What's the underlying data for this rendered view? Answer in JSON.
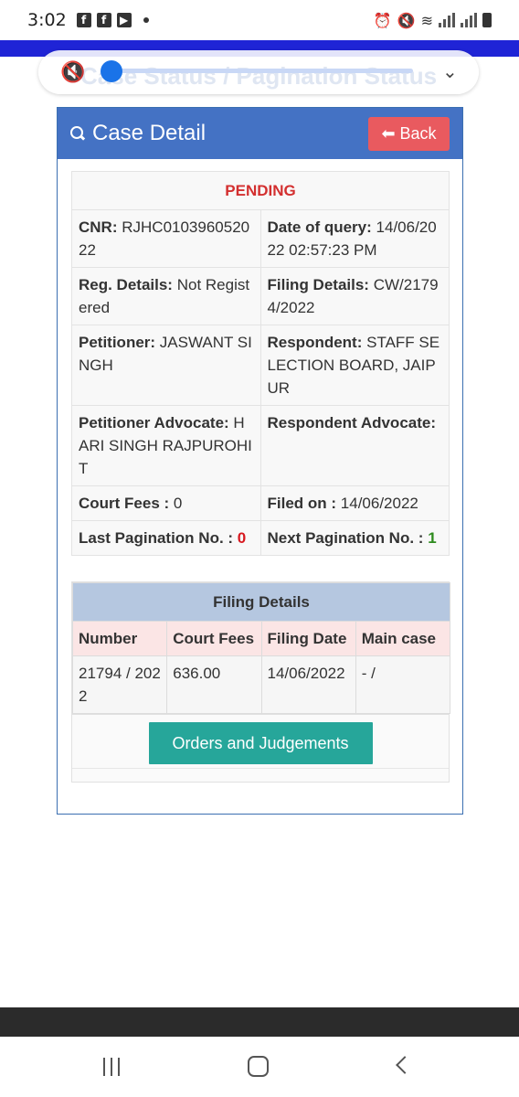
{
  "status_bar": {
    "time": "3:02"
  },
  "media_overlay": {
    "background_heading": "Case Status / Pagination Status"
  },
  "panel": {
    "title": "Case Detail",
    "back_label": "Back"
  },
  "case": {
    "status": "PENDING",
    "cnr_label": "CNR:",
    "cnr_value": "RJHC010396052022",
    "query_label": "Date of query:",
    "query_value": "14/06/2022 02:57:23 PM",
    "reg_label": "Reg. Details:",
    "reg_value": "Not Registered",
    "filing_label": "Filing Details:",
    "filing_value": "CW/21794/2022",
    "petitioner_label": "Petitioner:",
    "petitioner_value": "JASWANT SINGH",
    "respondent_label": "Respondent:",
    "respondent_value": "STAFF SELECTION BOARD, JAIPUR",
    "pet_adv_label": "Petitioner Advocate:",
    "pet_adv_value": "HARI SINGH RAJPUROHIT",
    "resp_adv_label": "Respondent Advocate:",
    "resp_adv_value": "",
    "court_fees_label": "Court Fees :",
    "court_fees_value": "0",
    "filed_on_label": "Filed on :",
    "filed_on_value": "14/06/2022",
    "last_pag_label": "Last Pagination No. :",
    "last_pag_value": "0",
    "next_pag_label": "Next Pagination No. :",
    "next_pag_value": "1"
  },
  "filing_table": {
    "title": "Filing Details",
    "headers": [
      "Number",
      "Court Fees",
      "Filing Date",
      "Main case"
    ],
    "rows": [
      [
        "21794 / 2022",
        "636.00",
        "14/06/2022",
        "- /"
      ]
    ]
  },
  "orders_button": "Orders and Judgements",
  "colors": {
    "header_blue": "#4472c4",
    "back_red": "#e95a5f",
    "status_red": "#d32f2f",
    "orders_teal": "#26a69a",
    "filing_title_bg": "#b5c7e0",
    "filing_header_bg": "#fbe5e5"
  }
}
